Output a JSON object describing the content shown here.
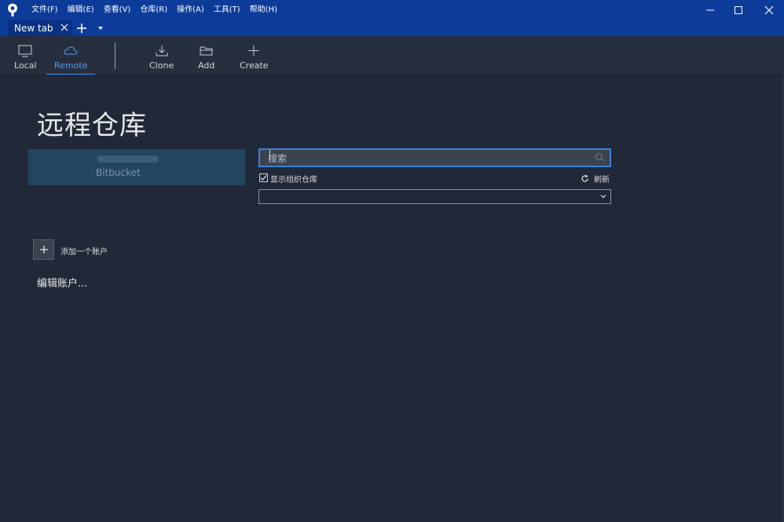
{
  "menu": [
    "文件(F)",
    "编辑(E)",
    "查看(V)",
    "仓库(R)",
    "操作(A)",
    "工具(T)",
    "帮助(H)"
  ],
  "tab": {
    "label": "New tab"
  },
  "toolbar": {
    "local": "Local",
    "remote": "Remote",
    "clone": "Clone",
    "add": "Add",
    "create": "Create"
  },
  "main": {
    "title": "远程仓库",
    "account": {
      "provider": "Bitbucket"
    },
    "search": {
      "placeholder": "搜索"
    },
    "show_org_repos": {
      "label": "显示组织仓库",
      "checked": true
    },
    "refresh": "刷新",
    "add_account": "添加一个账户",
    "edit_accounts": "编辑账户..."
  },
  "colors": {
    "titlebar": "#0c3b9a",
    "background": "#212938",
    "accent": "#4a9cf0"
  }
}
